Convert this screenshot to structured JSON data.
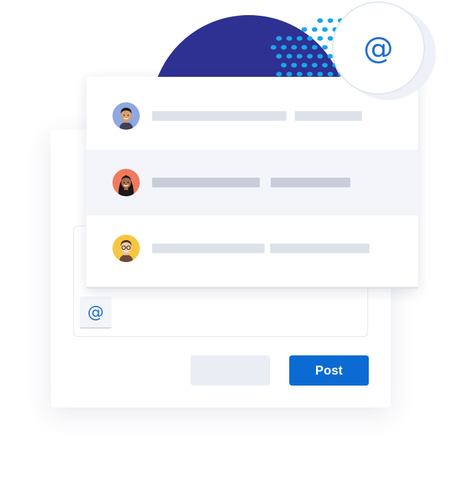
{
  "at_badge": {
    "symbol": "@",
    "icon": "at-sign-icon"
  },
  "mention_list": {
    "items": [
      {
        "avatar": "avatar-man-short-hair",
        "active": false
      },
      {
        "avatar": "avatar-woman-long-hair",
        "active": true
      },
      {
        "avatar": "avatar-man-glasses",
        "active": false
      }
    ]
  },
  "composer": {
    "mention_key": "@",
    "cancel_label": "",
    "post_label": "Post"
  },
  "colors": {
    "brand_navy": "#2e3192",
    "accent_blue": "#0b6bd3",
    "dot_blue": "#1aa6ee",
    "active_row": "#f3f5fb"
  }
}
